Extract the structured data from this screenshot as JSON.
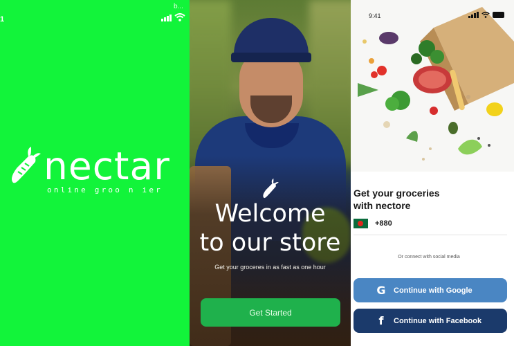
{
  "splash": {
    "status_left": "1",
    "status_top": "b...",
    "brand": "nectar",
    "tagline": "online groo n ier"
  },
  "welcome": {
    "title_line1": "Welcome",
    "title_line2": "to our store",
    "subtitle": "Get your groceres in as fast as one hour",
    "button_label": "Get Started"
  },
  "signin": {
    "time": "9:41",
    "title_line1": "Get your groceries",
    "title_line2": "with nectore",
    "country_code": "+880",
    "social_label": "Or connect with social media",
    "google_label": "Continue with Google",
    "facebook_label": "Continue with Facebook",
    "google_icon": "G",
    "facebook_icon": "f"
  },
  "colors": {
    "brand_green": "#12f43a",
    "button_green": "#1fb14c",
    "google_blue": "#4a86c3",
    "facebook_navy": "#1b3a6b"
  }
}
